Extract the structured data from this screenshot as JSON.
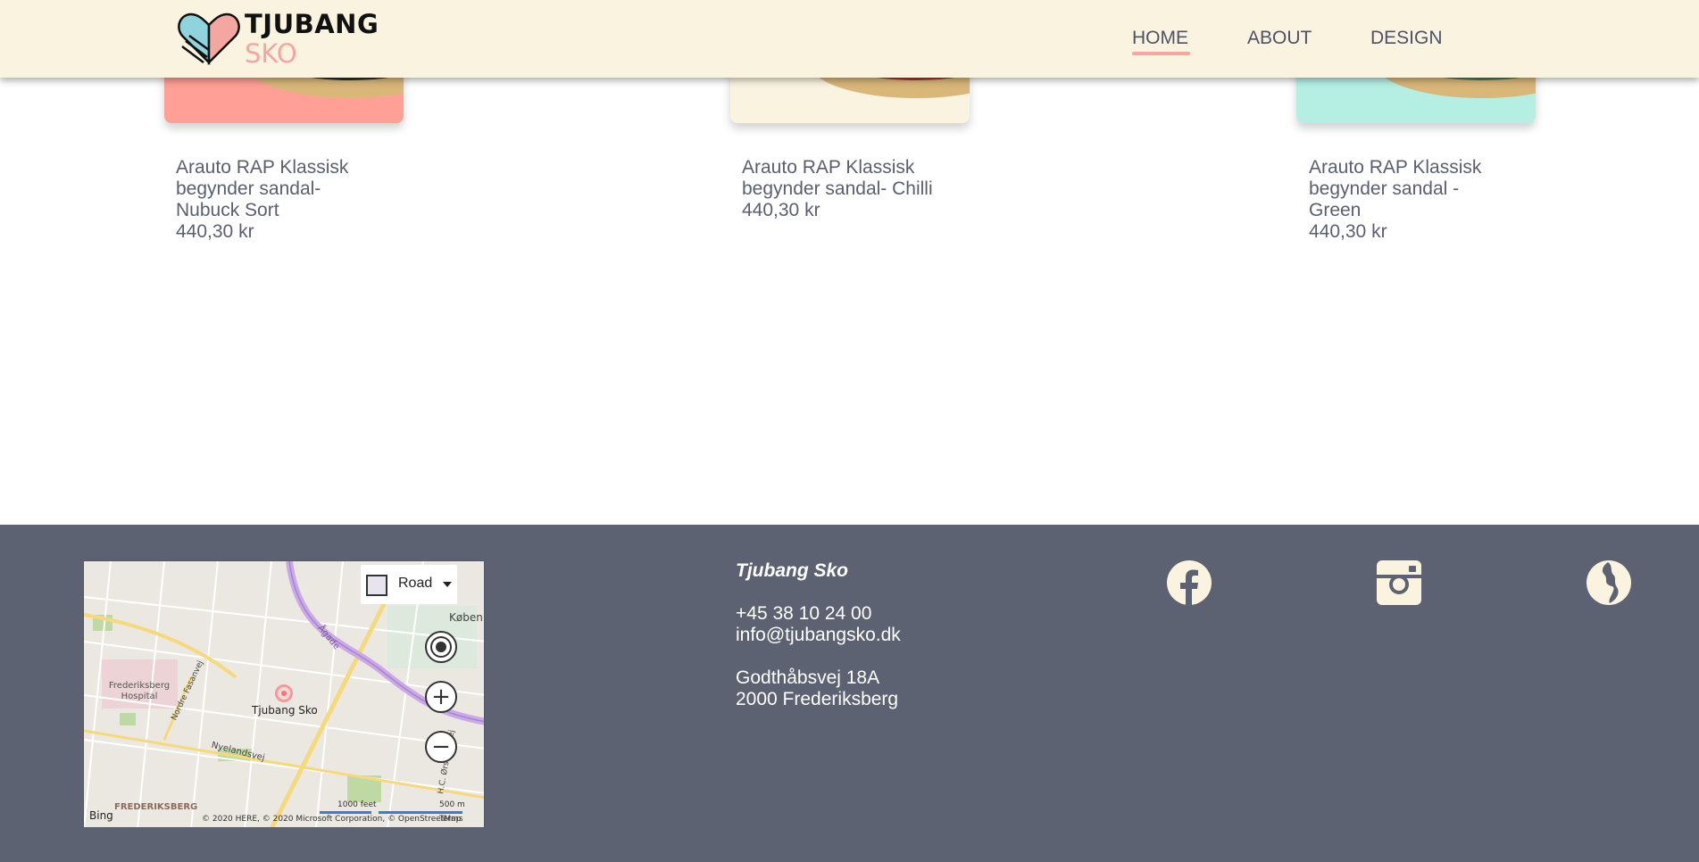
{
  "header": {
    "logo_top": "TJUBANG",
    "logo_bottom": "SKO",
    "nav": [
      {
        "label": "HOME",
        "active": true
      },
      {
        "label": "ABOUT",
        "active": false
      },
      {
        "label": "DESIGN",
        "active": false
      }
    ],
    "accent_color": "#f4a6a0",
    "background_color": "#faf3e0"
  },
  "products": [
    {
      "name": "Arauto RAP Klassisk begynder sandal- Nubuck Sort",
      "price": "440,30 kr",
      "card_color": "#ff9f96"
    },
    {
      "name": "Arauto RAP Klassisk begynder sandal- Chilli",
      "price": "440,30 kr",
      "card_color": "#faf3e0"
    },
    {
      "name": "Arauto RAP Klassisk begynder sandal - Green",
      "price": "440,30 kr",
      "card_color": "#b5efe4"
    }
  ],
  "footer": {
    "background_color": "#5c6272",
    "map": {
      "style_label": "Road",
      "place_label": "Tjubang Sko",
      "hospital_label": "Frederiksberg Hospital",
      "district_label": "FREDERIKSBERG",
      "city_label": "Køben",
      "street_labels": [
        "Ågade",
        "Nyelandsvej",
        "Nordre Fasanvej",
        "H.C. Ørsteds Vej"
      ],
      "scale_feet": "1000 feet",
      "scale_m": "500 m",
      "copyright": "© 2020 HERE, © 2020 Microsoft Corporation, © OpenStreetMap",
      "terms": "Terms",
      "provider": "Bing"
    },
    "company_name": "Tjubang Sko",
    "phone": "+45 38 10 24 00",
    "email": "info@tjubangsko.dk",
    "address_line1": "Godthåbsvej 18A",
    "address_line2": "2000 Frederiksberg",
    "social_icons": [
      "facebook-icon",
      "instagram-icon",
      "website-icon"
    ],
    "icon_color": "#faf3e0"
  }
}
